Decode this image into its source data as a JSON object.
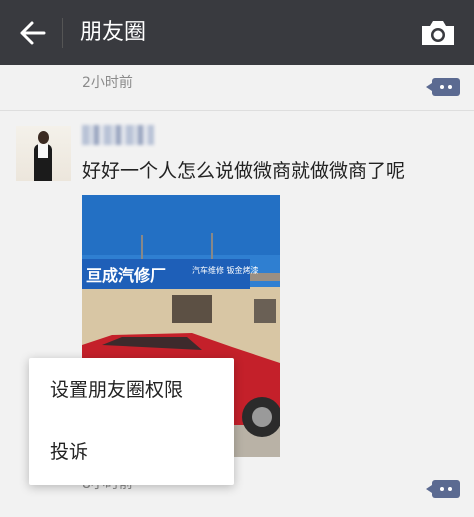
{
  "header": {
    "title": "朋友圈",
    "back_icon": "arrow-left-icon",
    "camera_icon": "camera-icon"
  },
  "feed": {
    "previous_post_time": "2小时前",
    "post": {
      "text": "好好一个人怎么说做微商就做微商了呢",
      "photo_sign_text": "亘成汽修厂",
      "photo_sign_side": "汽车维修 钣金烤漆",
      "time": "8小时前"
    }
  },
  "popup_menu": {
    "items": [
      {
        "label": "设置朋友圈权限"
      },
      {
        "label": "投诉"
      }
    ]
  },
  "colors": {
    "topbar": "#393a3f",
    "comment_button": "#5b6a91",
    "feed_background": "#f2f2f2"
  }
}
